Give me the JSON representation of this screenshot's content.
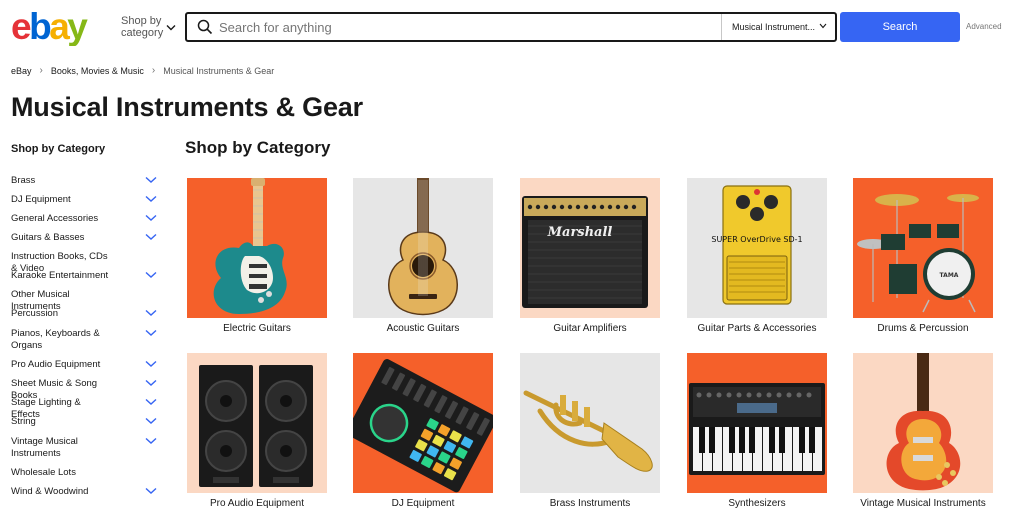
{
  "header": {
    "logo_letters": [
      "e",
      "b",
      "a",
      "y"
    ],
    "shop_by_category": "Shop by category",
    "search_placeholder": "Search for anything",
    "category_select": "Musical Instrument...",
    "search_button": "Search",
    "advanced_link": "Advanced"
  },
  "breadcrumb": [
    "eBay",
    "Books, Movies & Music",
    "Musical Instruments & Gear"
  ],
  "page_title": "Musical Instruments & Gear",
  "sidebar": {
    "heading": "Shop by Category",
    "items": [
      {
        "label": "Brass",
        "expandable": true
      },
      {
        "label": "DJ Equipment",
        "expandable": true
      },
      {
        "label": "General Accessories",
        "expandable": true
      },
      {
        "label": "Guitars & Basses",
        "expandable": true
      },
      {
        "label": "Instruction Books, CDs & Video",
        "expandable": false
      },
      {
        "label": "Karaoke Entertainment",
        "expandable": true
      },
      {
        "label": "Other Musical Instruments",
        "expandable": false
      },
      {
        "label": "Percussion",
        "expandable": true
      },
      {
        "label": "Pianos, Keyboards & Organs",
        "expandable": true
      },
      {
        "label": "Pro Audio Equipment",
        "expandable": true
      },
      {
        "label": "Sheet Music & Song Books",
        "expandable": true
      },
      {
        "label": "Stage Lighting & Effects",
        "expandable": true
      },
      {
        "label": "String",
        "expandable": true
      },
      {
        "label": "Vintage Musical Instruments",
        "expandable": true
      },
      {
        "label": "Wholesale Lots",
        "expandable": false
      },
      {
        "label": "Wind & Woodwind",
        "expandable": true
      }
    ]
  },
  "main": {
    "title": "Shop by Category",
    "tiles": [
      {
        "label": "Electric Guitars",
        "bg": "#f5602a",
        "art": "electric-guitar-image"
      },
      {
        "label": "Acoustic Guitars",
        "bg": "#e6e6e6",
        "art": "acoustic-guitar-image"
      },
      {
        "label": "Guitar Amplifiers",
        "bg": "#fbd8c3",
        "art": "guitar-amplifier-image",
        "brand": "Marshall"
      },
      {
        "label": "Guitar Parts & Accessories",
        "bg": "#e6e6e6",
        "art": "guitar-pedal-image",
        "brand": "SUPER OverDrive SD-1"
      },
      {
        "label": "Drums & Percussion",
        "bg": "#f5602a",
        "art": "drum-kit-image"
      },
      {
        "label": "Pro Audio Equipment",
        "bg": "#fbd8c3",
        "art": "speakers-image"
      },
      {
        "label": "DJ Equipment",
        "bg": "#f5602a",
        "art": "dj-controller-image"
      },
      {
        "label": "Brass Instruments",
        "bg": "#e6e6e6",
        "art": "trumpet-image"
      },
      {
        "label": "Synthesizers",
        "bg": "#f5602a",
        "art": "synthesizer-image"
      },
      {
        "label": "Vintage Musical Instruments",
        "bg": "#fbd8c3",
        "art": "vintage-guitar-image"
      }
    ]
  },
  "colors": {
    "logo_e": "#e53238",
    "logo_b": "#0064d2",
    "logo_a": "#f5af02",
    "logo_y": "#86b817",
    "search_button": "#3665f3",
    "chevron": "#3665f3",
    "tile_orange": "#f5602a",
    "tile_peach": "#fbd8c3",
    "tile_grey": "#e6e6e6"
  }
}
